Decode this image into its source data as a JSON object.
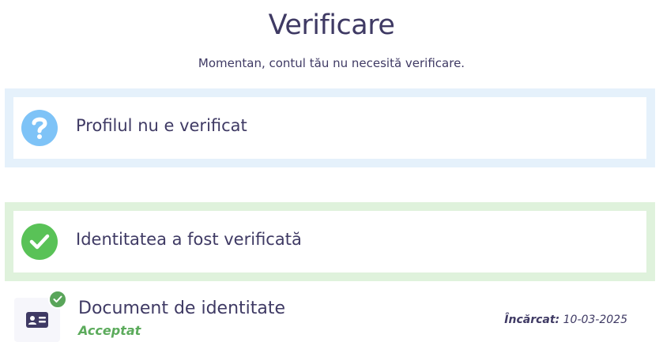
{
  "header": {
    "title": "Verificare",
    "subtitle": "Momentan, contul tău nu necesită verificare."
  },
  "cards": [
    {
      "label": "Profilul nu e verificat",
      "icon": "question-circle-icon",
      "color": "#7ec3f7",
      "frame_color": "#e5f1fb"
    },
    {
      "label": "Identitatea a fost verificată",
      "icon": "check-circle-icon",
      "color": "#59c257",
      "frame_color": "#dff2dc"
    }
  ],
  "document": {
    "title": "Document de identitate",
    "status": "Acceptat",
    "status_color": "#5cab5c",
    "uploaded_label": "Încărcat:",
    "uploaded_date": "10-03-2025",
    "icon": "id-card-icon",
    "badge_icon": "check-badge-icon"
  }
}
